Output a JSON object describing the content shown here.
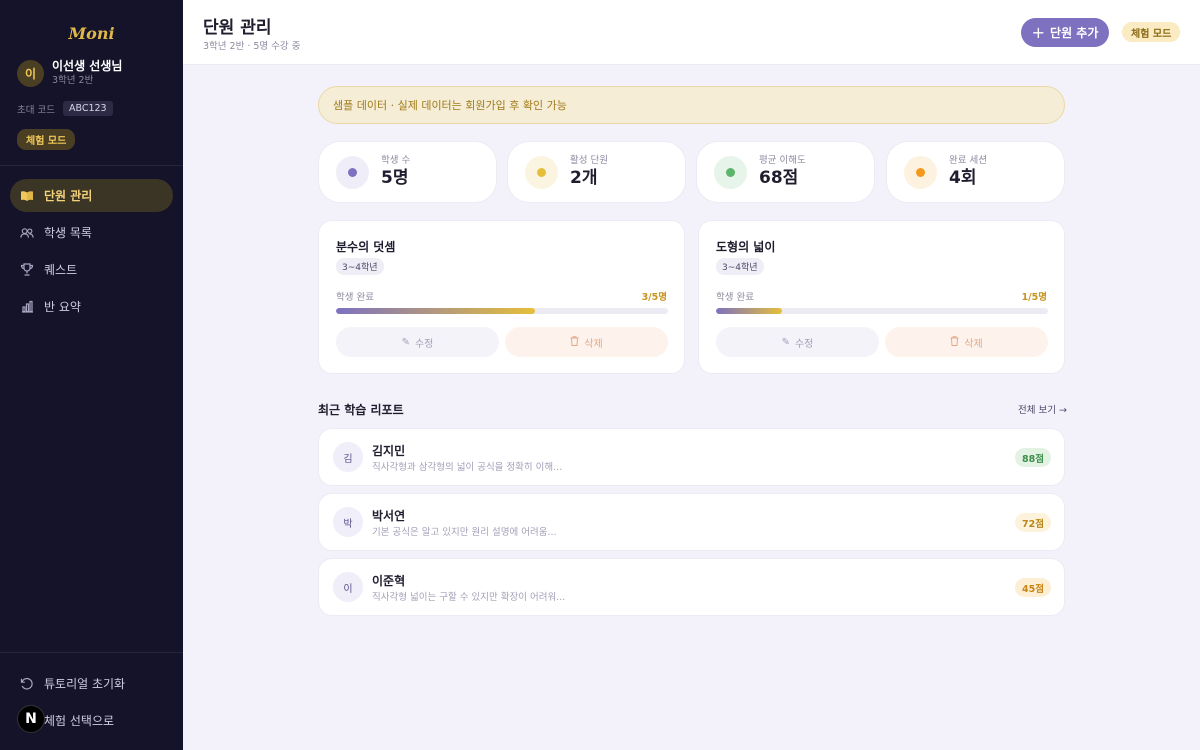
{
  "sidebar": {
    "logo": "Moni",
    "profile": {
      "avatar": "이",
      "name": "이선생 선생님",
      "class": "3학년 2반"
    },
    "invite": {
      "label": "초대 코드",
      "code": "ABC123"
    },
    "trial_badge": "체험 모드",
    "nav": [
      {
        "label": "단원 관리",
        "icon": "book-icon",
        "active": true
      },
      {
        "label": "학생 목록",
        "icon": "users-icon",
        "active": false
      },
      {
        "label": "퀘스트",
        "icon": "trophy-icon",
        "active": false
      },
      {
        "label": "반 요약",
        "icon": "bar-chart-icon",
        "active": false
      }
    ],
    "reset_tutorial": "튜토리얼 초기화",
    "back_to_select": "체험 선택으로",
    "n_badge": "N"
  },
  "header": {
    "title": "단원 관리",
    "subtitle": "3학년 2반 · 5명 수강 중",
    "add_button": "단원 추가",
    "mode_badge": "체험 모드"
  },
  "notice": "샘플 데이터 · 실제 데이터는 회원가입 후 확인 가능",
  "stats": [
    {
      "label": "학생 수",
      "value": "5명",
      "dot_color": "#7d71c0",
      "bg_color": "#efeef8"
    },
    {
      "label": "활성 단원",
      "value": "2개",
      "dot_color": "#e6bf3a",
      "bg_color": "#fbf4e1"
    },
    {
      "label": "평균 이해도",
      "value": "68점",
      "dot_color": "#5cb56b",
      "bg_color": "#e7f4e9"
    },
    {
      "label": "완료 세션",
      "value": "4회",
      "dot_color": "#f39a1c",
      "bg_color": "#fdf1e0"
    }
  ],
  "units": [
    {
      "title": "분수의 덧셈",
      "grade": "3~4학년",
      "progress_label": "학생 완료",
      "progress_text": "3/5명",
      "progress": 0.6,
      "edit": "수정",
      "delete": "삭제"
    },
    {
      "title": "도형의 넓이",
      "grade": "3~4학년",
      "progress_label": "학생 완료",
      "progress_text": "1/5명",
      "progress": 0.2,
      "edit": "수정",
      "delete": "삭제"
    }
  ],
  "reports": {
    "title": "최근 학습 리포트",
    "view_all": "전체 보기 →",
    "items": [
      {
        "avatar": "김",
        "name": "김지민",
        "desc": "직사각형과 삼각형의 넓이 공식을 정확히 이해...",
        "score": "88점",
        "tone": "green"
      },
      {
        "avatar": "박",
        "name": "박서연",
        "desc": "기본 공식은 알고 있지만 원리 설명에 어려움...",
        "score": "72점",
        "tone": "yellow"
      },
      {
        "avatar": "이",
        "name": "이준혁",
        "desc": "직사각형 넓이는 구할 수 있지만 확장이 어려워...",
        "score": "45점",
        "tone": "orange"
      }
    ]
  }
}
